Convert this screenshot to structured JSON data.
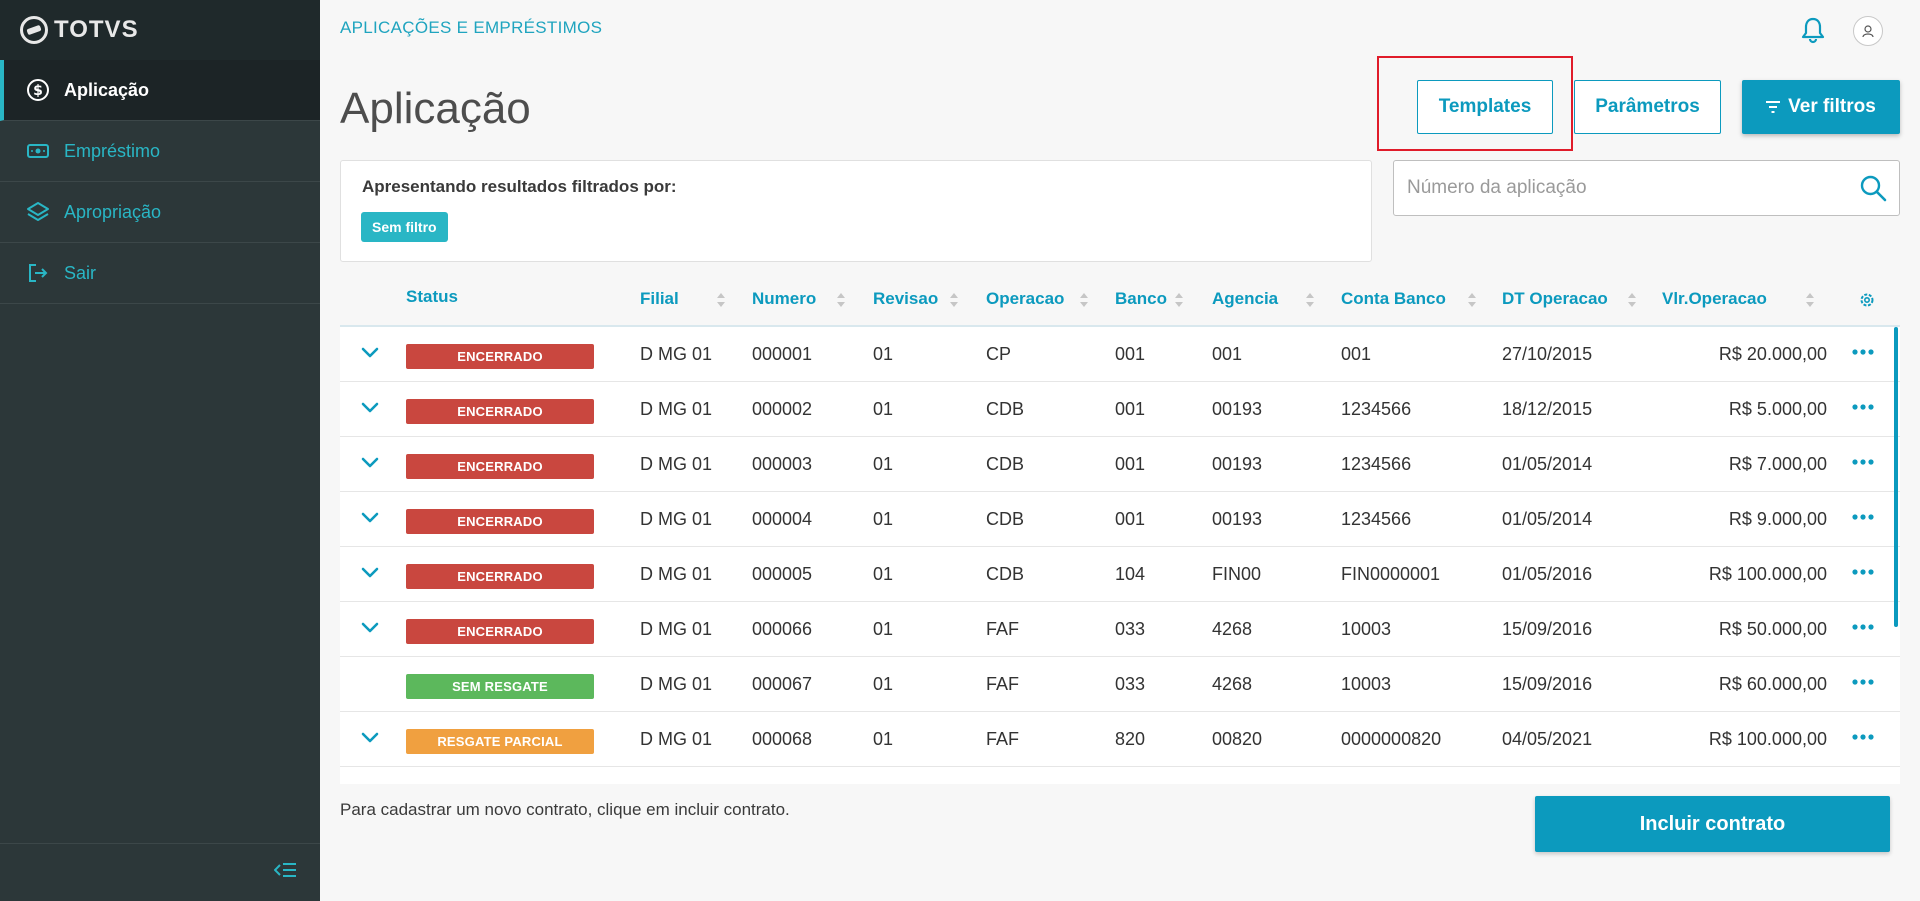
{
  "brand": {
    "name": "TOTVS"
  },
  "sidebar": {
    "items": [
      {
        "label": "Aplicação",
        "icon": "dollar-circle-icon",
        "active": true
      },
      {
        "label": "Empréstimo",
        "icon": "money-icon",
        "active": false
      },
      {
        "label": "Apropriação",
        "icon": "layers-icon",
        "active": false
      },
      {
        "label": "Sair",
        "icon": "logout-icon",
        "active": false
      }
    ],
    "collapse_icon": "collapse-menu-icon"
  },
  "header": {
    "breadcrumb": "APLICAÇÕES E EMPRÉSTIMOS",
    "title": "Aplicação"
  },
  "actions": {
    "templates": "Templates",
    "parameters": "Parâmetros",
    "filters": "Ver filtros"
  },
  "filter_box": {
    "label": "Apresentando resultados filtrados por:",
    "chip": "Sem filtro"
  },
  "search": {
    "placeholder": "Número da aplicação"
  },
  "table": {
    "columns": [
      "Status",
      "Filial",
      "Numero",
      "Revisao",
      "Operacao",
      "Banco",
      "Agencia",
      "Conta Banco",
      "DT Operacao",
      "Vlr.Operacao"
    ],
    "rows": [
      {
        "expandable": true,
        "status": "ENCERRADO",
        "status_color": "#c9473f",
        "filial": "D MG 01",
        "numero": "000001",
        "revisao": "01",
        "operacao": "CP",
        "banco": "001",
        "agencia": "001",
        "conta": "001",
        "dt": "27/10/2015",
        "valor": "R$ 20.000,00"
      },
      {
        "expandable": true,
        "status": "ENCERRADO",
        "status_color": "#c9473f",
        "filial": "D MG 01",
        "numero": "000002",
        "revisao": "01",
        "operacao": "CDB",
        "banco": "001",
        "agencia": "00193",
        "conta": "1234566",
        "dt": "18/12/2015",
        "valor": "R$ 5.000,00"
      },
      {
        "expandable": true,
        "status": "ENCERRADO",
        "status_color": "#c9473f",
        "filial": "D MG 01",
        "numero": "000003",
        "revisao": "01",
        "operacao": "CDB",
        "banco": "001",
        "agencia": "00193",
        "conta": "1234566",
        "dt": "01/05/2014",
        "valor": "R$ 7.000,00"
      },
      {
        "expandable": true,
        "status": "ENCERRADO",
        "status_color": "#c9473f",
        "filial": "D MG 01",
        "numero": "000004",
        "revisao": "01",
        "operacao": "CDB",
        "banco": "001",
        "agencia": "00193",
        "conta": "1234566",
        "dt": "01/05/2014",
        "valor": "R$ 9.000,00"
      },
      {
        "expandable": true,
        "status": "ENCERRADO",
        "status_color": "#c9473f",
        "filial": "D MG 01",
        "numero": "000005",
        "revisao": "01",
        "operacao": "CDB",
        "banco": "104",
        "agencia": "FIN00",
        "conta": "FIN0000001",
        "dt": "01/05/2016",
        "valor": "R$ 100.000,00"
      },
      {
        "expandable": true,
        "status": "ENCERRADO",
        "status_color": "#c9473f",
        "filial": "D MG 01",
        "numero": "000066",
        "revisao": "01",
        "operacao": "FAF",
        "banco": "033",
        "agencia": "4268",
        "conta": "10003",
        "dt": "15/09/2016",
        "valor": "R$ 50.000,00"
      },
      {
        "expandable": false,
        "status": "SEM RESGATE",
        "status_color": "#5cb85c",
        "filial": "D MG 01",
        "numero": "000067",
        "revisao": "01",
        "operacao": "FAF",
        "banco": "033",
        "agencia": "4268",
        "conta": "10003",
        "dt": "15/09/2016",
        "valor": "R$ 60.000,00"
      },
      {
        "expandable": true,
        "status": "RESGATE PARCIAL",
        "status_color": "#f0a040",
        "filial": "D MG 01",
        "numero": "000068",
        "revisao": "01",
        "operacao": "FAF",
        "banco": "820",
        "agencia": "00820",
        "conta": "0000000820",
        "dt": "04/05/2021",
        "valor": "R$ 100.000,00"
      }
    ]
  },
  "footer": {
    "hint": "Para cadastrar um novo contrato, clique em incluir contrato.",
    "include_button": "Incluir contrato"
  },
  "colors": {
    "primary": "#0c9abe",
    "accent": "#29b6c5",
    "sidebar": "#2c3739",
    "highlight": "#e01c2a"
  }
}
